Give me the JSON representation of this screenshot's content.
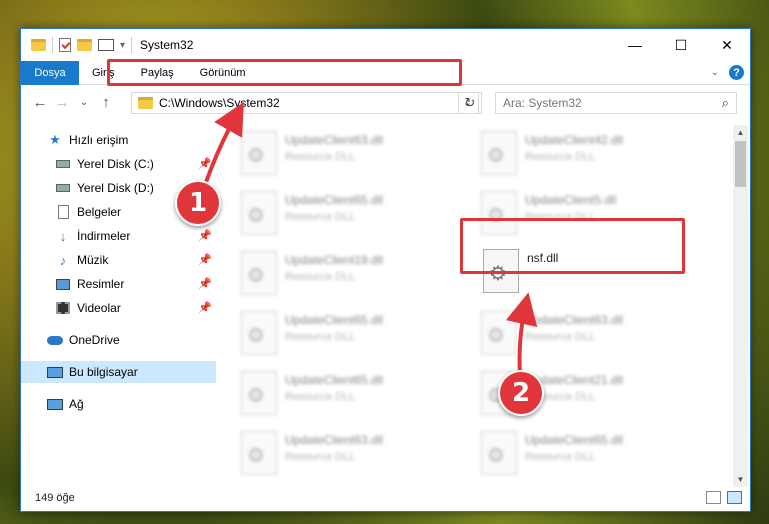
{
  "window": {
    "title": "System32",
    "minimize": "—",
    "maximize": "☐",
    "close": "✕"
  },
  "ribbon": {
    "tabs": [
      {
        "label": "Dosya"
      },
      {
        "label": "Giriş"
      },
      {
        "label": "Paylaş"
      },
      {
        "label": "Görünüm"
      }
    ],
    "help": "?",
    "expand": "⌄"
  },
  "navigation": {
    "back": "←",
    "forward": "→",
    "recent": "⌄",
    "up": "↑",
    "address": "C:\\Windows\\System32",
    "address_chevron": "⌄",
    "refresh": "↻",
    "search_placeholder": "Ara: System32",
    "search_icon": "⌕"
  },
  "sidebar": {
    "items": [
      {
        "label": "Hızlı erişim",
        "icon": "star-icon",
        "glyph": "★"
      },
      {
        "label": "Yerel Disk (C:)",
        "icon": "drive-icon",
        "pinned": "📌"
      },
      {
        "label": "Yerel Disk (D:)",
        "icon": "drive-icon",
        "pinned": "📌"
      },
      {
        "label": "Belgeler",
        "icon": "document-icon",
        "pinned": "📌"
      },
      {
        "label": "İndirmeler",
        "icon": "download-icon",
        "glyph": "↓",
        "pinned": "📌"
      },
      {
        "label": "Müzik",
        "icon": "music-icon",
        "glyph": "♪",
        "pinned": "📌"
      },
      {
        "label": "Resimler",
        "icon": "pictures-icon",
        "pinned": "📌"
      },
      {
        "label": "Videolar",
        "icon": "videos-icon",
        "pinned": "📌"
      },
      {
        "label": "OneDrive",
        "icon": "cloud-icon"
      },
      {
        "label": "Bu bilgisayar",
        "icon": "computer-icon"
      },
      {
        "label": "Ağ",
        "icon": "network-icon"
      }
    ]
  },
  "files": [
    {
      "name": "UpdateClient63.dll",
      "type": "Resource DLL"
    },
    {
      "name": "UpdateClient42.dll",
      "type": "Resource DLL"
    },
    {
      "name": "UpdateClient65.dll",
      "type": "Resource DLL"
    },
    {
      "name": "UpdateClient5.dll",
      "type": "Resource DLL"
    },
    {
      "name": "UpdateClient19.dll",
      "type": "Resource DLL"
    },
    {
      "name": "nsf.dll",
      "type": ""
    },
    {
      "name": "UpdateClient65.dll",
      "type": "Resource DLL"
    },
    {
      "name": "UpdateClient63.dll",
      "type": "Resource DLL"
    },
    {
      "name": "UpdateClient65.dll",
      "type": "Resource DLL"
    },
    {
      "name": "UpdateClient21.dll",
      "type": "Resource DLL"
    },
    {
      "name": "UpdateClient63.dll",
      "type": "Resource DLL"
    },
    {
      "name": "UpdateClient65.dll",
      "type": "Resource DLL"
    }
  ],
  "status": {
    "item_count": "149 öğe"
  },
  "callouts": {
    "one": "1",
    "two": "2"
  },
  "colors": {
    "accent": "#1979ca",
    "highlight": "#e0353a",
    "selected": "#cce8ff"
  }
}
